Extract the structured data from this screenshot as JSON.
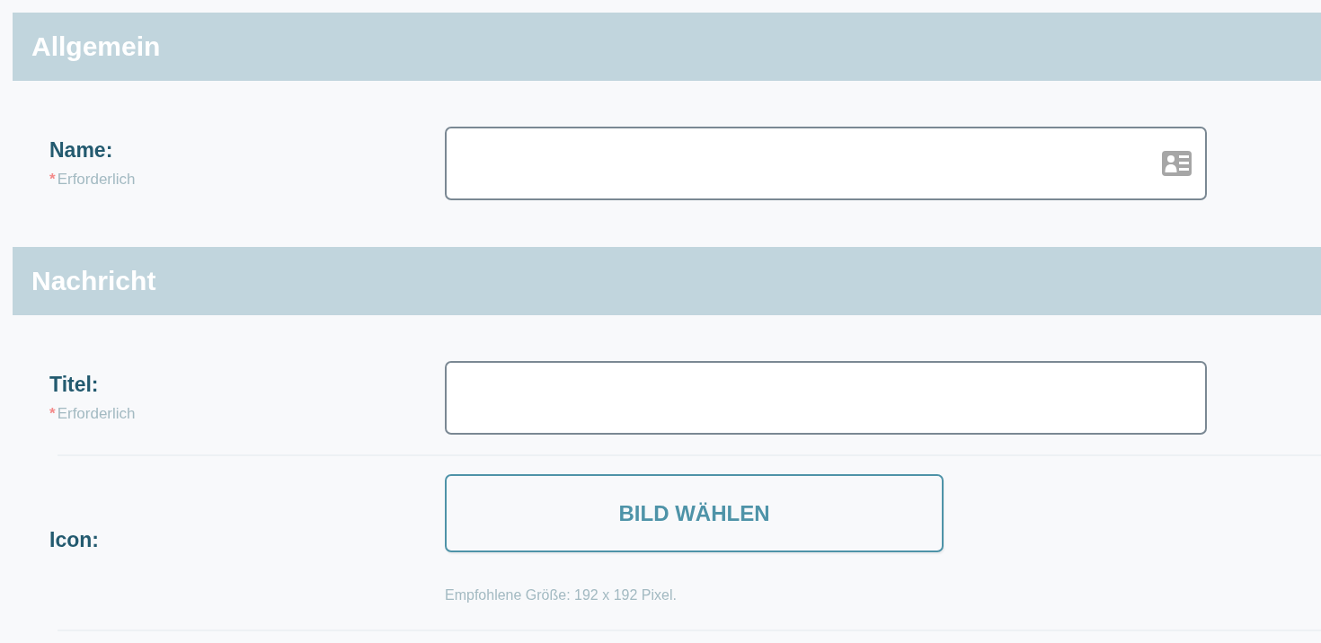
{
  "sections": [
    {
      "title": "Allgemein",
      "fields": [
        {
          "kind": "card-input",
          "label": "Name:",
          "required_mark": "*",
          "required_text": "Erforderlich"
        }
      ]
    },
    {
      "title": "Nachricht",
      "fields": [
        {
          "kind": "input",
          "label": "Titel:",
          "required_mark": "*",
          "required_text": "Erforderlich"
        },
        {
          "kind": "image-picker",
          "label": "Icon:",
          "button": "BILD WÄHLEN",
          "hint": "Empfohlene Größe: 192 x 192 Pixel."
        }
      ]
    }
  ]
}
